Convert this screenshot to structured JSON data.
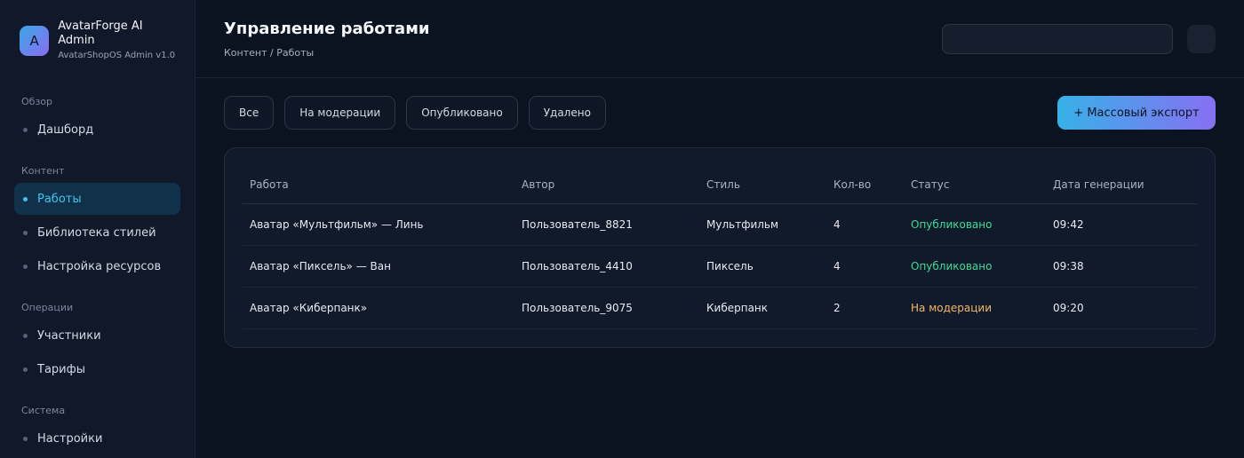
{
  "brand": {
    "logo_letter": "A",
    "title": "AvatarForge AI Admin",
    "subtitle": "AvatarShopOS Admin v1.0"
  },
  "sidebar": {
    "sections": [
      {
        "label": "Обзор",
        "items": [
          {
            "label": "Дашборд",
            "active": false
          }
        ]
      },
      {
        "label": "Контент",
        "items": [
          {
            "label": "Работы",
            "active": true
          },
          {
            "label": "Библиотека стилей",
            "active": false
          },
          {
            "label": "Настройка ресурсов",
            "active": false
          }
        ]
      },
      {
        "label": "Операции",
        "items": [
          {
            "label": "Участники",
            "active": false
          },
          {
            "label": "Тарифы",
            "active": false
          }
        ]
      },
      {
        "label": "Система",
        "items": [
          {
            "label": "Настройки",
            "active": false
          }
        ]
      }
    ]
  },
  "header": {
    "title": "Управление работами",
    "breadcrumb": "Контент / Работы",
    "search_value": ""
  },
  "filters": [
    "Все",
    "На модерации",
    "Опубликовано",
    "Удалено"
  ],
  "export_label": "+ Массовый экспорт",
  "table": {
    "columns": [
      "Работа",
      "Автор",
      "Стиль",
      "Кол-во",
      "Статус",
      "Дата генерации"
    ],
    "rows": [
      {
        "work": "Аватар «Мультфильм» — Линь",
        "author": "Пользователь_8821",
        "style": "Мультфильм",
        "count": "4",
        "status": "Опубликовано",
        "status_color": "#3ddc97",
        "date": "09:42"
      },
      {
        "work": "Аватар «Пиксель» — Ван",
        "author": "Пользователь_4410",
        "style": "Пиксель",
        "count": "4",
        "status": "Опубликовано",
        "status_color": "#3ddc97",
        "date": "09:38"
      },
      {
        "work": "Аватар «Киберпанк»",
        "author": "Пользователь_9075",
        "style": "Киберпанк",
        "count": "2",
        "status": "На модерации",
        "status_color": "#f5b862",
        "date": "09:20"
      }
    ]
  },
  "colors": {
    "accent": "#3fc4f0",
    "published": "#3ddc97",
    "moderation": "#f5b862"
  }
}
